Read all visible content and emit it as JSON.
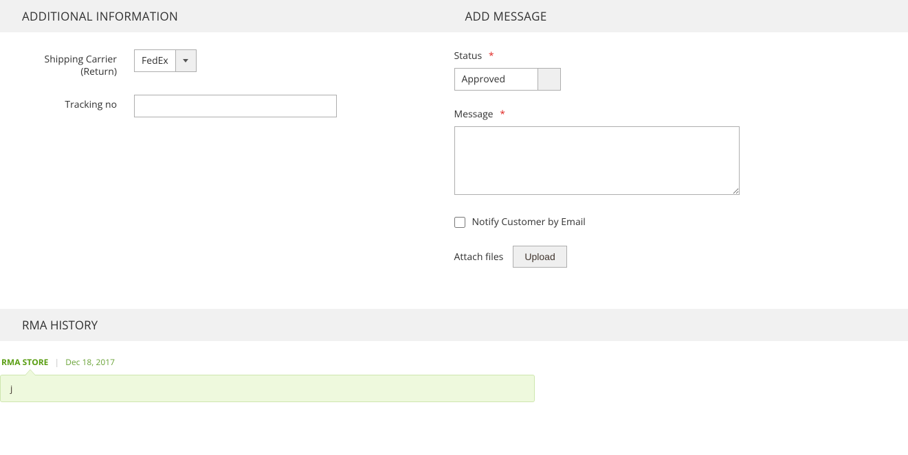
{
  "additional": {
    "heading": "ADDITIONAL INFORMATION",
    "shipping_label": "Shipping Carrier (Return)",
    "shipping_value": "FedEx",
    "tracking_label": "Tracking no",
    "tracking_value": ""
  },
  "addmsg": {
    "heading": "ADD MESSAGE",
    "status_label": "Status",
    "status_value": "Approved",
    "message_label": "Message",
    "message_value": "",
    "notify_label": "Notify Customer by Email",
    "attach_label": "Attach files",
    "upload_label": "Upload"
  },
  "history": {
    "heading": "RMA HISTORY",
    "items": [
      {
        "store": "RMA STORE",
        "date": "Dec 18, 2017",
        "text": "j"
      }
    ]
  }
}
